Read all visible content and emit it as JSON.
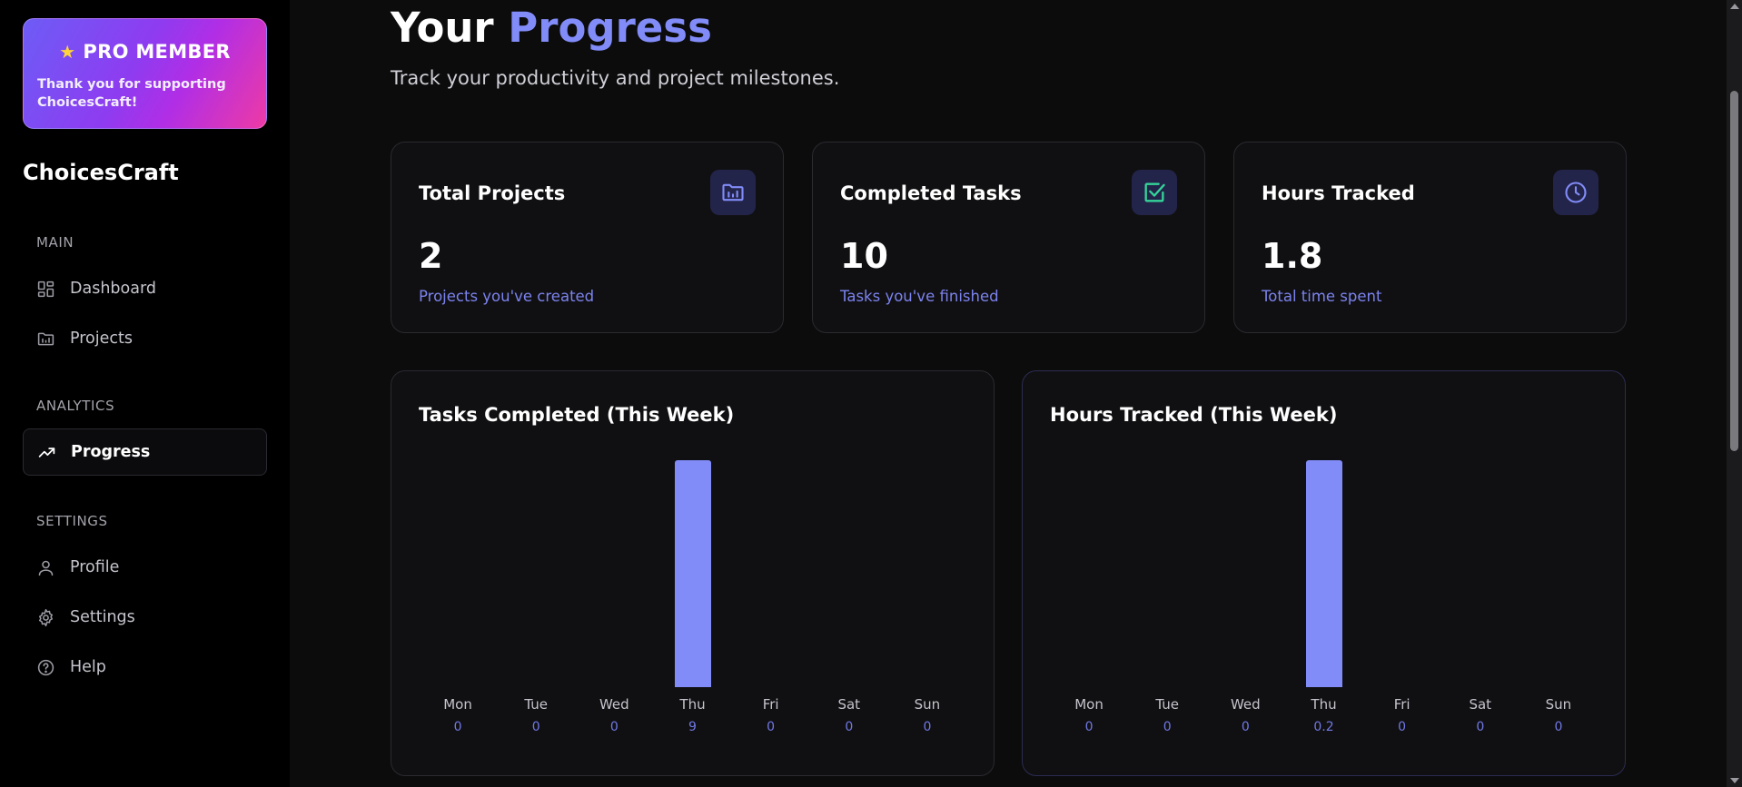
{
  "pro": {
    "star": "★",
    "title": "PRO MEMBER",
    "subtitle": "Thank you for supporting ChoicesCraft!"
  },
  "brand": "ChoicesCraft",
  "sidebar": {
    "main_label": "MAIN",
    "analytics_label": "ANALYTICS",
    "settings_label": "SETTINGS",
    "items": {
      "dashboard": {
        "label": "Dashboard",
        "icon": "dashboard-grid-icon"
      },
      "projects": {
        "label": "Projects",
        "icon": "folder-chart-icon"
      },
      "progress": {
        "label": "Progress",
        "icon": "trending-up-icon",
        "active": true
      },
      "profile": {
        "label": "Profile",
        "icon": "user-icon"
      },
      "settings": {
        "label": "Settings",
        "icon": "gear-icon"
      },
      "help": {
        "label": "Help",
        "icon": "help-circle-icon"
      }
    }
  },
  "header": {
    "title_plain": "Your",
    "title_accent": "Progress",
    "subtitle": "Track your productivity and project milestones."
  },
  "stats": [
    {
      "title": "Total Projects",
      "value": "2",
      "desc": "Projects you've created",
      "icon": "folder-chart-icon",
      "icon_color": "#818cf8"
    },
    {
      "title": "Completed Tasks",
      "value": "10",
      "desc": "Tasks you've finished",
      "icon": "check-square-icon",
      "icon_color": "#34d399"
    },
    {
      "title": "Hours Tracked",
      "value": "1.8",
      "desc": "Total time spent",
      "icon": "clock-icon",
      "icon_color": "#818cf8"
    }
  ],
  "chart_data": [
    {
      "type": "bar",
      "title": "Tasks Completed (This Week)",
      "categories": [
        "Mon",
        "Tue",
        "Wed",
        "Thu",
        "Fri",
        "Sat",
        "Sun"
      ],
      "values": [
        0,
        0,
        0,
        9,
        0,
        0,
        0
      ],
      "value_labels": [
        "0",
        "0",
        "0",
        "9",
        "0",
        "0",
        "0"
      ],
      "bar_color": "#818cf8"
    },
    {
      "type": "bar",
      "title": "Hours Tracked (This Week)",
      "categories": [
        "Mon",
        "Tue",
        "Wed",
        "Thu",
        "Fri",
        "Sat",
        "Sun"
      ],
      "values": [
        0,
        0,
        0,
        0.2,
        0,
        0,
        0
      ],
      "value_labels": [
        "0",
        "0",
        "0",
        "0.2",
        "0",
        "0",
        "0"
      ],
      "bar_color": "#818cf8"
    }
  ],
  "colors": {
    "accent": "#818cf8",
    "bg": "#0c0c0d",
    "sidebar_bg": "#000000"
  }
}
